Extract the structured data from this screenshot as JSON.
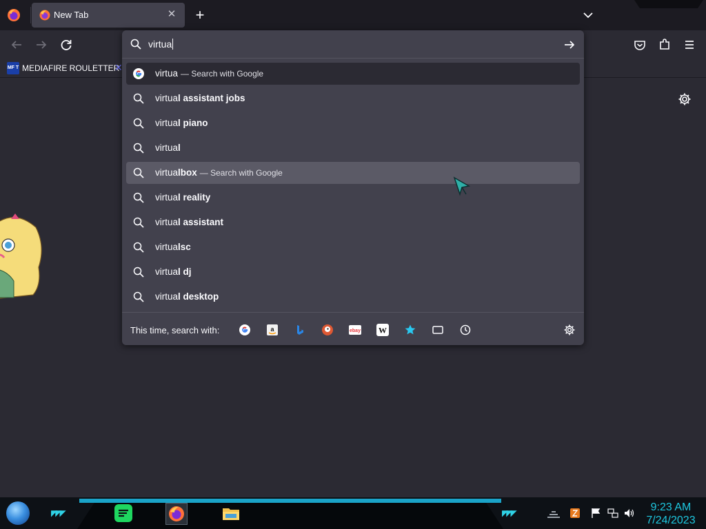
{
  "tabs": [
    {
      "title": "New Tab"
    }
  ],
  "urlbar": {
    "input_value": "virtua",
    "suggestions": [
      {
        "prefix": "virtua",
        "bold": "",
        "action": "Search with Google",
        "icon": "google-icon",
        "state": "selected"
      },
      {
        "prefix": "virtua",
        "bold": "l assistant jobs",
        "action": "",
        "icon": "search-icon",
        "state": ""
      },
      {
        "prefix": "virtua",
        "bold": "l piano",
        "action": "",
        "icon": "search-icon",
        "state": ""
      },
      {
        "prefix": "virtua",
        "bold": "l",
        "action": "",
        "icon": "search-icon",
        "state": ""
      },
      {
        "prefix": "virtua",
        "bold": "lbox",
        "action": "Search with Google",
        "icon": "search-icon",
        "state": "hover"
      },
      {
        "prefix": "virtua",
        "bold": "l reality",
        "action": "",
        "icon": "search-icon",
        "state": ""
      },
      {
        "prefix": "virtua",
        "bold": "l assistant",
        "action": "",
        "icon": "search-icon",
        "state": ""
      },
      {
        "prefix": "virtua",
        "bold": "lsc",
        "action": "",
        "icon": "search-icon",
        "state": ""
      },
      {
        "prefix": "virtua",
        "bold": "l dj",
        "action": "",
        "icon": "search-icon",
        "state": ""
      },
      {
        "prefix": "virtua",
        "bold": "l desktop",
        "action": "",
        "icon": "search-icon",
        "state": ""
      }
    ],
    "oneoff_label": "This time, search with:",
    "engines": [
      "google-icon",
      "amazon-icon",
      "bing-icon",
      "duckduckgo-icon",
      "ebay-icon",
      "wikipedia-icon",
      "bookmarks-star-icon",
      "tabs-icon",
      "history-icon"
    ]
  },
  "bookmarks": {
    "items": [
      {
        "label": "MEDIAFIRE ROULETTER",
        "icon_text": "MF T"
      }
    ]
  },
  "taskbar": {
    "time": "9:23 AM",
    "date": "7/24/2023"
  },
  "colors": {
    "accent": "#1aa3c8",
    "clock": "#1ec8e0",
    "toolbar": "#2b2a33",
    "popup": "#42414d"
  }
}
